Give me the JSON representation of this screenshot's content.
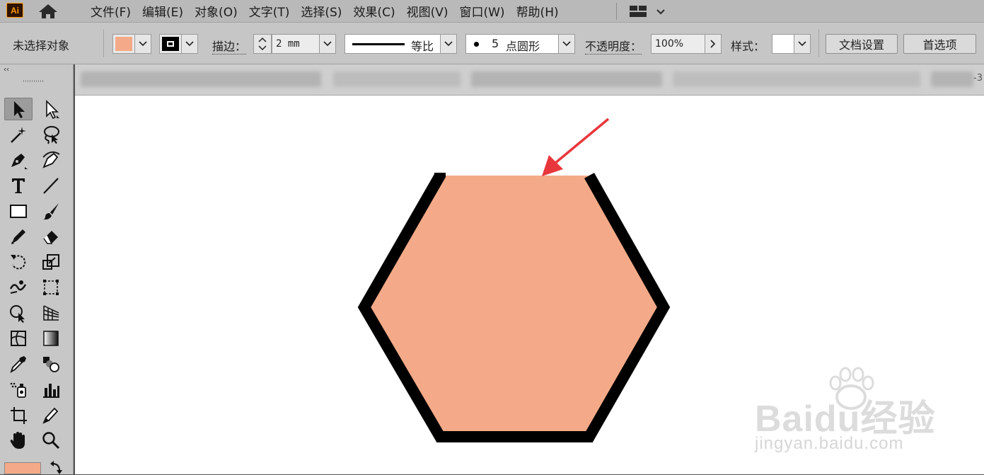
{
  "app": {
    "logo_text": "Ai"
  },
  "menu": [
    {
      "label": "文件(F)"
    },
    {
      "label": "编辑(E)"
    },
    {
      "label": "对象(O)"
    },
    {
      "label": "文字(T)"
    },
    {
      "label": "选择(S)"
    },
    {
      "label": "效果(C)"
    },
    {
      "label": "视图(V)"
    },
    {
      "label": "窗口(W)"
    },
    {
      "label": "帮助(H)"
    }
  ],
  "control_bar": {
    "selection_status": "未选择对象",
    "fill_color": "#f4aa88",
    "stroke_color": "#000000",
    "stroke_label": "描边：",
    "stroke_weight": "2 mm",
    "profile_label": "等比",
    "brush_size": "5",
    "brush_label": "点圆形",
    "opacity_label": "不透明度：",
    "opacity_value": "100%",
    "style_label": "样式：",
    "doc_setup_button": "文档设置",
    "preferences_button": "首选项"
  },
  "tools": [
    "selection-tool",
    "direct-selection-tool",
    "magic-wand-tool",
    "lasso-tool",
    "pen-tool",
    "curvature-tool",
    "type-tool",
    "line-segment-tool",
    "rectangle-tool",
    "paintbrush-tool",
    "shaper-tool",
    "eraser-tool",
    "rotate-tool",
    "scale-tool",
    "warp-tool",
    "free-transform-tool",
    "shape-builder-tool",
    "perspective-grid-tool",
    "mesh-tool",
    "gradient-tool",
    "eyedropper-tool",
    "blend-tool",
    "symbol-sprayer-tool",
    "column-graph-tool",
    "artboard-tool",
    "slice-tool",
    "hand-tool",
    "zoom-tool"
  ],
  "artwork": {
    "shape": "hexagon",
    "fill": "#f4aa88",
    "stroke": "#000000",
    "annotation_arrow_color": "#e8373c",
    "top_edge_open": true
  },
  "watermark": {
    "brand": "Baidu经验",
    "url": "jingyan.baidu.com"
  }
}
